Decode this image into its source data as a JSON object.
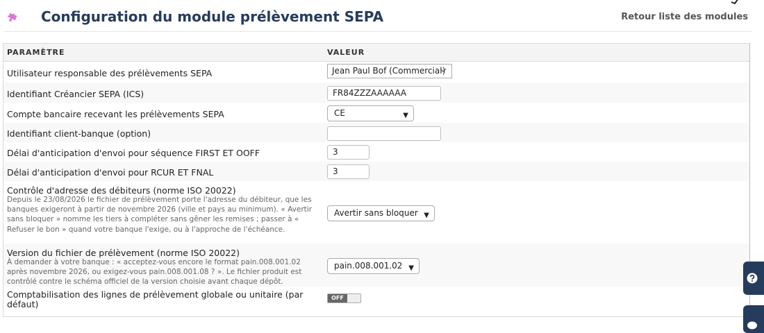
{
  "header": {
    "title": "Configuration du module prélèvement SEPA",
    "back_link": "Retour liste des modules"
  },
  "table": {
    "col_param": "PARAMÈTRE",
    "col_value": "VALEUR"
  },
  "rows": [
    {
      "label": "Utilisateur responsable des prélèvements SEPA",
      "value": "Jean Paul Bof (Commercial)"
    },
    {
      "label": "Identifiant Créancier SEPA (ICS)",
      "value": "FR84ZZZAAAAAA"
    },
    {
      "label": "Compte bancaire recevant les prélèvements SEPA",
      "value": "CE"
    },
    {
      "label": "Identifiant client-banque (option)",
      "value": ""
    },
    {
      "label": "Délai d'anticipation d'envoi pour séquence FIRST ET OOFF",
      "value": "3"
    },
    {
      "label": "Délai d'anticipation d'envoi pour RCUR ET FNAL",
      "value": "3"
    },
    {
      "label": "Contrôle d'adresse des débiteurs (norme ISO 20022)",
      "description": "Depuis le 23/08/2026 le fichier de prélèvement porte l'adresse du débiteur, que les banques exigeront à partir de novembre 2026 (ville et pays au minimum). « Avertir sans bloquer » nomme les tiers à compléter sans gêner les remises ; passer à « Refuser le bon » quand votre banque l'exige, ou à l'approche de l'échéance.",
      "value": "Avertir sans bloquer"
    },
    {
      "label": "Version du fichier de prélèvement (norme ISO 20022)",
      "description": "À demander à votre banque : « acceptez-vous encore le format pain.008.001.02 après novembre 2026, ou exigez-vous pain.008.001.08 ? ». Le fichier produit est contrôlé contre le schéma officiel de la version choisie avant chaque dépôt.",
      "value": "pain.008.001.02"
    },
    {
      "label": "Comptabilisation des lignes de prélèvement globale ou unitaire (par défaut)",
      "value": "OFF"
    }
  ],
  "colors": {
    "title": "#263c5c",
    "accent": "#cc66cc"
  },
  "icons": {
    "module": "puzzle-icon",
    "help": "question-circle-icon",
    "chat": "chat-icon",
    "dropdown": "chevron-down-icon"
  }
}
